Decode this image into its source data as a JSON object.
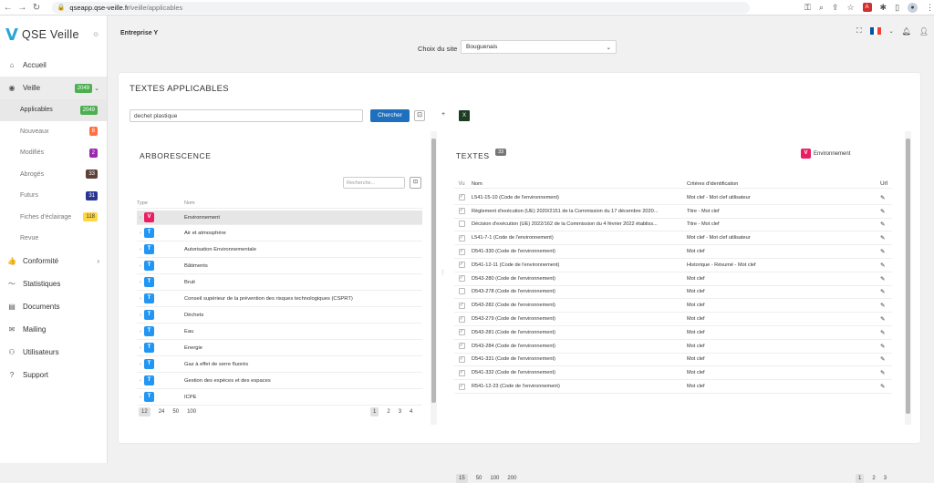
{
  "browser": {
    "url_host": "qseapp.qse-veille.fr",
    "url_path": "/veille/applicables"
  },
  "app": {
    "name": "QSE Veille",
    "company": "Entreprise Y"
  },
  "site": {
    "label": "Choix du site",
    "value": "Bouguenais"
  },
  "sidebar": {
    "items": [
      {
        "label": "Accueil",
        "icon": "home-icon"
      },
      {
        "label": "Veille",
        "icon": "eye-icon",
        "badge": "2049"
      },
      {
        "label": "Conformité",
        "icon": "thumb-icon"
      },
      {
        "label": "Statistiques",
        "icon": "chart-icon"
      },
      {
        "label": "Documents",
        "icon": "document-icon"
      },
      {
        "label": "Mailing",
        "icon": "mail-icon"
      },
      {
        "label": "Utilisateurs",
        "icon": "users-icon"
      },
      {
        "label": "Support",
        "icon": "help-icon"
      }
    ],
    "sub": [
      {
        "label": "Applicables",
        "badge": "2049"
      },
      {
        "label": "Nouveaux",
        "badge": "8"
      },
      {
        "label": "Modifiés",
        "badge": "2"
      },
      {
        "label": "Abrogés",
        "badge": "33"
      },
      {
        "label": "Futurs",
        "badge": "31"
      },
      {
        "label": "Fiches d'éclairage",
        "badge": "118"
      },
      {
        "label": "Revue",
        "badge": ""
      }
    ]
  },
  "main": {
    "title": "TEXTES APPLICABLES",
    "search_value": "dechet plastique",
    "search_button": "Chercher",
    "add": "+",
    "excel": "X"
  },
  "arbo": {
    "title": "ARBORESCENCE",
    "search_placeholder": "Recherche...",
    "col_type": "Type",
    "col_nom": "Nom",
    "rows": [
      {
        "type": "V",
        "nom": "Environnement"
      },
      {
        "type": "T",
        "nom": "Air et atmosphère"
      },
      {
        "type": "T",
        "nom": "Autorisation Environnementale"
      },
      {
        "type": "T",
        "nom": "Bâtiments"
      },
      {
        "type": "T",
        "nom": "Bruit"
      },
      {
        "type": "T",
        "nom": "Conseil supérieur de la prévention des risques technologiques (CSPRT)"
      },
      {
        "type": "T",
        "nom": "Déchets"
      },
      {
        "type": "T",
        "nom": "Eau"
      },
      {
        "type": "T",
        "nom": "Energie"
      },
      {
        "type": "T",
        "nom": "Gaz à effet de serre fluorés"
      },
      {
        "type": "T",
        "nom": "Gestion des espèces et des espaces"
      },
      {
        "type": "T",
        "nom": "ICPE"
      }
    ],
    "page_sizes": [
      "12",
      "24",
      "50",
      "100"
    ],
    "pages": [
      "1",
      "2",
      "3",
      "4"
    ]
  },
  "textes": {
    "title": "TEXTES",
    "count": "33",
    "filter": {
      "badge": "V",
      "label": "Environnement"
    },
    "col_vu": "Vu",
    "col_nom": "Nom",
    "col_crit": "Critères d'identification",
    "col_url": "Url",
    "rows": [
      {
        "vu": true,
        "nom": "L541-15-10 (Code de l'environnement)",
        "crit": "Mot clef - Mot clef utilisateur"
      },
      {
        "vu": true,
        "nom": "Règlement d'exécution (UE) 2020/2151 de la Commission du 17 décembre 2020...",
        "crit": "Titre - Mot clef"
      },
      {
        "vu": false,
        "nom": "Décision d'exécution (UE) 2022/162 de la Commission du 4 février 2022 établiss...",
        "crit": "Titre - Mot clef"
      },
      {
        "vu": true,
        "nom": "L541-7-1 (Code de l'environnement)",
        "crit": "Mot clef - Mot clef utilisateur"
      },
      {
        "vu": true,
        "nom": "D541-330 (Code de l'environnement)",
        "crit": "Mot clef"
      },
      {
        "vu": true,
        "nom": "D541-12-11 (Code de l'environnement)",
        "crit": "Historique - Résumé - Mot clef"
      },
      {
        "vu": true,
        "nom": "D543-280 (Code de l'environnement)",
        "crit": "Mot clef"
      },
      {
        "vu": false,
        "nom": "D543-278 (Code de l'environnement)",
        "crit": "Mot clef"
      },
      {
        "vu": true,
        "nom": "D543-282 (Code de l'environnement)",
        "crit": "Mot clef"
      },
      {
        "vu": true,
        "nom": "D543-279 (Code de l'environnement)",
        "crit": "Mot clef"
      },
      {
        "vu": true,
        "nom": "D543-281 (Code de l'environnement)",
        "crit": "Mot clef"
      },
      {
        "vu": true,
        "nom": "D543-284 (Code de l'environnement)",
        "crit": "Mot clef"
      },
      {
        "vu": true,
        "nom": "D541-331 (Code de l'environnement)",
        "crit": "Mot clef"
      },
      {
        "vu": true,
        "nom": "D541-332 (Code de l'environnement)",
        "crit": "Mot clef"
      },
      {
        "vu": true,
        "nom": "R541-12-23 (Code de l'environnement)",
        "crit": "Mot clef"
      }
    ],
    "page_sizes": [
      "15",
      "50",
      "100",
      "200"
    ],
    "pages": [
      "1",
      "2",
      "3"
    ]
  },
  "colors": {
    "accent": "#1e6fbd",
    "type_t": "#2196f3",
    "type_v": "#e91e63",
    "logo": "#2aa7d6"
  }
}
